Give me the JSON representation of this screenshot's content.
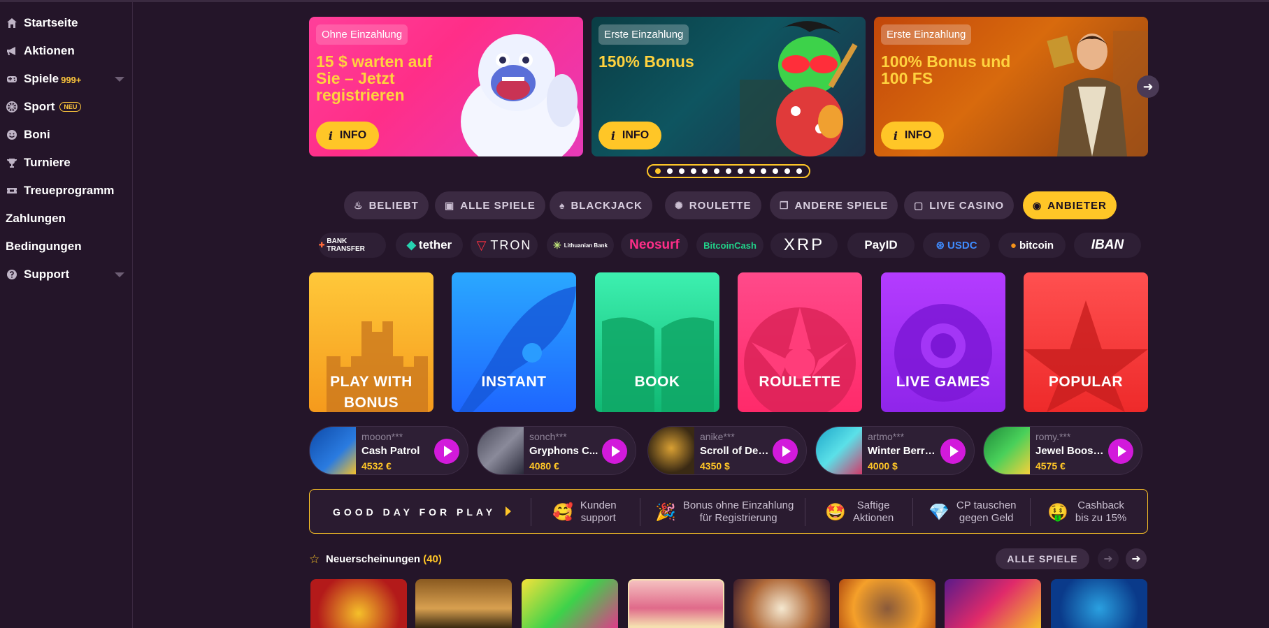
{
  "sidebar": {
    "items": [
      {
        "label": "Startseite",
        "icon": "home-icon"
      },
      {
        "label": "Aktionen",
        "icon": "megaphone-icon"
      },
      {
        "label": "Spiele",
        "icon": "gamepad-icon",
        "count": "999+"
      },
      {
        "label": "Sport",
        "icon": "sport-icon",
        "badge": "NEU"
      },
      {
        "label": "Boni",
        "icon": "smiley-icon"
      },
      {
        "label": "Turniere",
        "icon": "trophy-icon"
      },
      {
        "label": "Treueprogramm",
        "icon": "ticket-icon"
      },
      {
        "label": "Zahlungen"
      },
      {
        "label": "Bedingungen"
      },
      {
        "label": "Support",
        "icon": "help-icon"
      }
    ]
  },
  "banners": [
    {
      "tag": "Ohne Einzahlung",
      "title": "15 $ warten auf Sie – Jetzt registrieren",
      "button": "INFO"
    },
    {
      "tag": "Erste Einzahlung",
      "title": "150% Bonus",
      "button": "INFO"
    },
    {
      "tag": "Erste Einzahlung",
      "title": "100% Bonus und 100 FS",
      "button": "INFO"
    }
  ],
  "carousel": {
    "total": 13,
    "active": 0
  },
  "categories": [
    {
      "label": "BELIEBT",
      "icon": "flame-icon"
    },
    {
      "label": "ALLE SPIELE",
      "icon": "gamepad-icon"
    },
    {
      "label": "BLACKJACK",
      "icon": "spade-icon"
    },
    {
      "label": "ROULETTE",
      "icon": "roulette-icon"
    },
    {
      "label": "ANDERE SPIELE",
      "icon": "cards-icon"
    },
    {
      "label": "LIVE CASINO",
      "icon": "live-icon"
    },
    {
      "label": "ANBIETER",
      "icon": "provider-icon",
      "active": true
    }
  ],
  "payments": [
    {
      "label": "BANK TRANSFER"
    },
    {
      "label": "tether"
    },
    {
      "label": "TRON"
    },
    {
      "label": "Lithuanian Bank"
    },
    {
      "label": "Neosurf"
    },
    {
      "label": "BitcoinCash"
    },
    {
      "label": "XRP"
    },
    {
      "label": "PayID"
    },
    {
      "label": "USDC"
    },
    {
      "label": "bitcoin"
    },
    {
      "label": "IBAN"
    }
  ],
  "tiles": [
    {
      "label": "PLAY WITH BONUS"
    },
    {
      "label": "INSTANT"
    },
    {
      "label": "BOOK"
    },
    {
      "label": "ROULETTE"
    },
    {
      "label": "LIVE GAMES"
    },
    {
      "label": "POPULAR"
    }
  ],
  "winners": [
    {
      "user": "mooon***",
      "game": "Cash Patrol",
      "amount": "4532 €"
    },
    {
      "user": "sonch***",
      "game": "Gryphons C...",
      "amount": "4080 €"
    },
    {
      "user": "anike***",
      "game": "Scroll of Dead",
      "amount": "4350 $"
    },
    {
      "user": "artmo***",
      "game": "Winter Berries",
      "amount": "4000 $"
    },
    {
      "user": "romy.***",
      "game": "Jewel Boost...",
      "amount": "4575 €"
    }
  ],
  "goodday": {
    "title": "GOOD DAY FOR PLAY",
    "items": [
      {
        "line1": "Kunden",
        "line2": "support",
        "emoji": "🥰"
      },
      {
        "line1": "Bonus ohne Einzahlung",
        "line2": "für Registrierung",
        "emoji": "🎉"
      },
      {
        "line1": "Saftige",
        "line2": "Aktionen",
        "emoji": "🤩"
      },
      {
        "line1": "CP tauschen",
        "line2": "gegen Geld",
        "emoji": "💎"
      },
      {
        "line1": "Cashback",
        "line2": "bis zu 15%",
        "emoji": "🤑"
      }
    ]
  },
  "new_releases": {
    "title": "Neuerscheinungen",
    "count": "(40)",
    "all_button": "ALLE SPIELE"
  }
}
